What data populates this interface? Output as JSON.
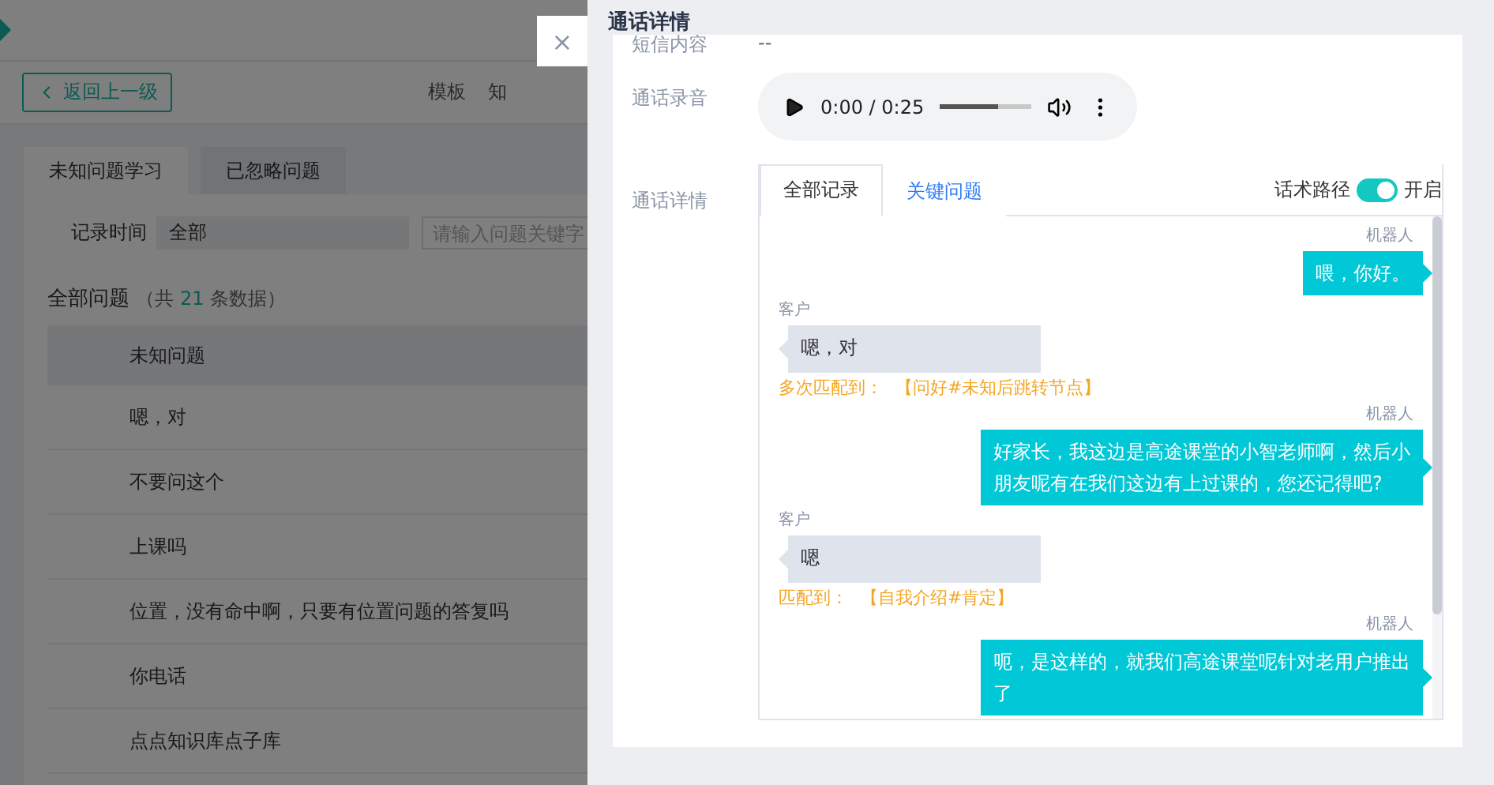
{
  "page": {
    "back_button": "返回上一级",
    "toolbar_links": [
      "模板",
      "知"
    ],
    "tabs": [
      {
        "label": "未知问题学习",
        "selected": true
      },
      {
        "label": "已忽略问题",
        "selected": false
      }
    ],
    "filter": {
      "label": "记录时间",
      "select_value": "全部",
      "search_placeholder": "请输入问题关键字"
    },
    "summary": {
      "title": "全部问题",
      "prefix": "（共",
      "count": "21",
      "suffix": "条数据）"
    },
    "table": {
      "columns": [
        "未知问题"
      ],
      "rows": [
        [
          "嗯，对"
        ],
        [
          "不要问这个"
        ],
        [
          "上课吗"
        ],
        [
          "位置，没有命中啊，只要有位置问题的答复吗"
        ],
        [
          "你电话"
        ],
        [
          "点点知识库点子库"
        ]
      ]
    }
  },
  "close_button": "×",
  "drawer": {
    "title": "通话详情",
    "sms": {
      "label": "短信内容",
      "value": "--"
    },
    "recording": {
      "label": "通话录音",
      "time": "0:00 / 0:25",
      "level": 0.63
    },
    "details": {
      "label": "通话详情",
      "tabs": [
        {
          "label": "全部记录",
          "selected": true
        },
        {
          "label": "关键问题",
          "selected": false
        }
      ],
      "path_toggle": {
        "label": "话术路径",
        "on": true,
        "state_text": "开启"
      },
      "messages": [
        {
          "kind": "robot",
          "speaker": "机器人",
          "text": "喂，你好。"
        },
        {
          "kind": "customer",
          "speaker": "客户",
          "text": "嗯，对",
          "match_label": "多次匹配到：",
          "match_value": "【问好#未知后跳转节点】"
        },
        {
          "kind": "robot",
          "speaker": "机器人",
          "text": "好家长，我这边是高途课堂的小智老师啊，然后小朋友呢有在我们这边有上过课的，您还记得吧?"
        },
        {
          "kind": "customer",
          "speaker": "客户",
          "text": "嗯",
          "match_label": "匹配到：",
          "match_value": "【自我介绍#肯定】"
        },
        {
          "kind": "robot",
          "speaker": "机器人",
          "text": "呃，是这样的，就我们高途课堂呢针对老用户推出了"
        }
      ]
    }
  }
}
